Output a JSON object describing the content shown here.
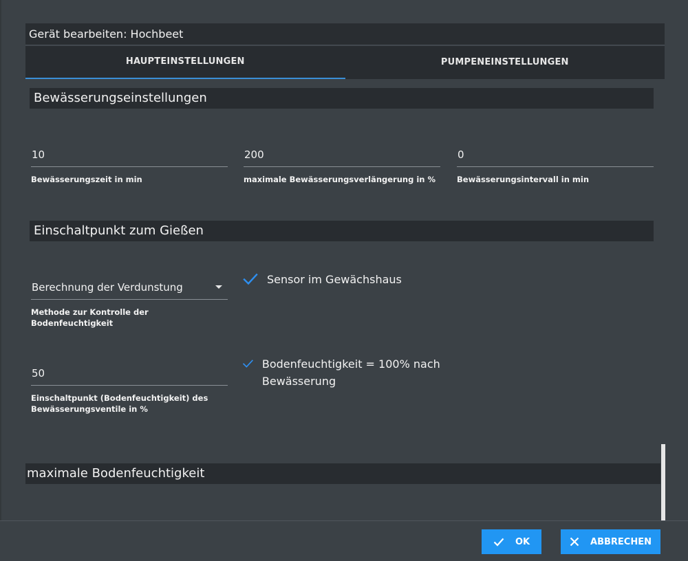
{
  "dialog": {
    "title": "Gerät bearbeiten: Hochbeet"
  },
  "tabs": [
    {
      "label": "HAUPTEINSTELLUNGEN",
      "active": true
    },
    {
      "label": "PUMPENEINSTELLUNGEN",
      "active": false
    }
  ],
  "sections": {
    "watering": {
      "title": "Bewässerungseinstellungen",
      "fields": [
        {
          "value": "10",
          "label": "Bewässerungszeit in min"
        },
        {
          "value": "200",
          "label": "maximale Bewässerungsverlängerung in %"
        },
        {
          "value": "0",
          "label": "Bewässerungsintervall in min"
        }
      ]
    },
    "trigger": {
      "title": "Einschaltpunkt zum Gießen",
      "method_select": {
        "value": "Berechnung der Verdunstung",
        "label": "Methode zur Kontrolle der Bodenfeuchtigkeit"
      },
      "threshold": {
        "value": "50",
        "label": "Einschaltpunkt (Bodenfeuchtigkeit) des Bewässerungsventile in %"
      },
      "checkboxes": [
        {
          "label": "Sensor im Gewächshaus",
          "checked": true
        },
        {
          "label": "Bodenfeuchtigkeit = 100% nach Bewässerung",
          "checked": true
        }
      ]
    },
    "max_moisture": {
      "title": "maximale Bodenfeuchtigkeit"
    }
  },
  "footer": {
    "ok_label": "OK",
    "cancel_label": "ABBRECHEN"
  },
  "colors": {
    "accent": "#2196f3",
    "tab_indicator": "#3a8fd8",
    "check": "#2e8ff0",
    "background": "#3b4146",
    "header_background": "#282c30"
  },
  "icons": {
    "ok": "check-icon",
    "cancel": "close-icon",
    "select": "caret-down-icon"
  }
}
